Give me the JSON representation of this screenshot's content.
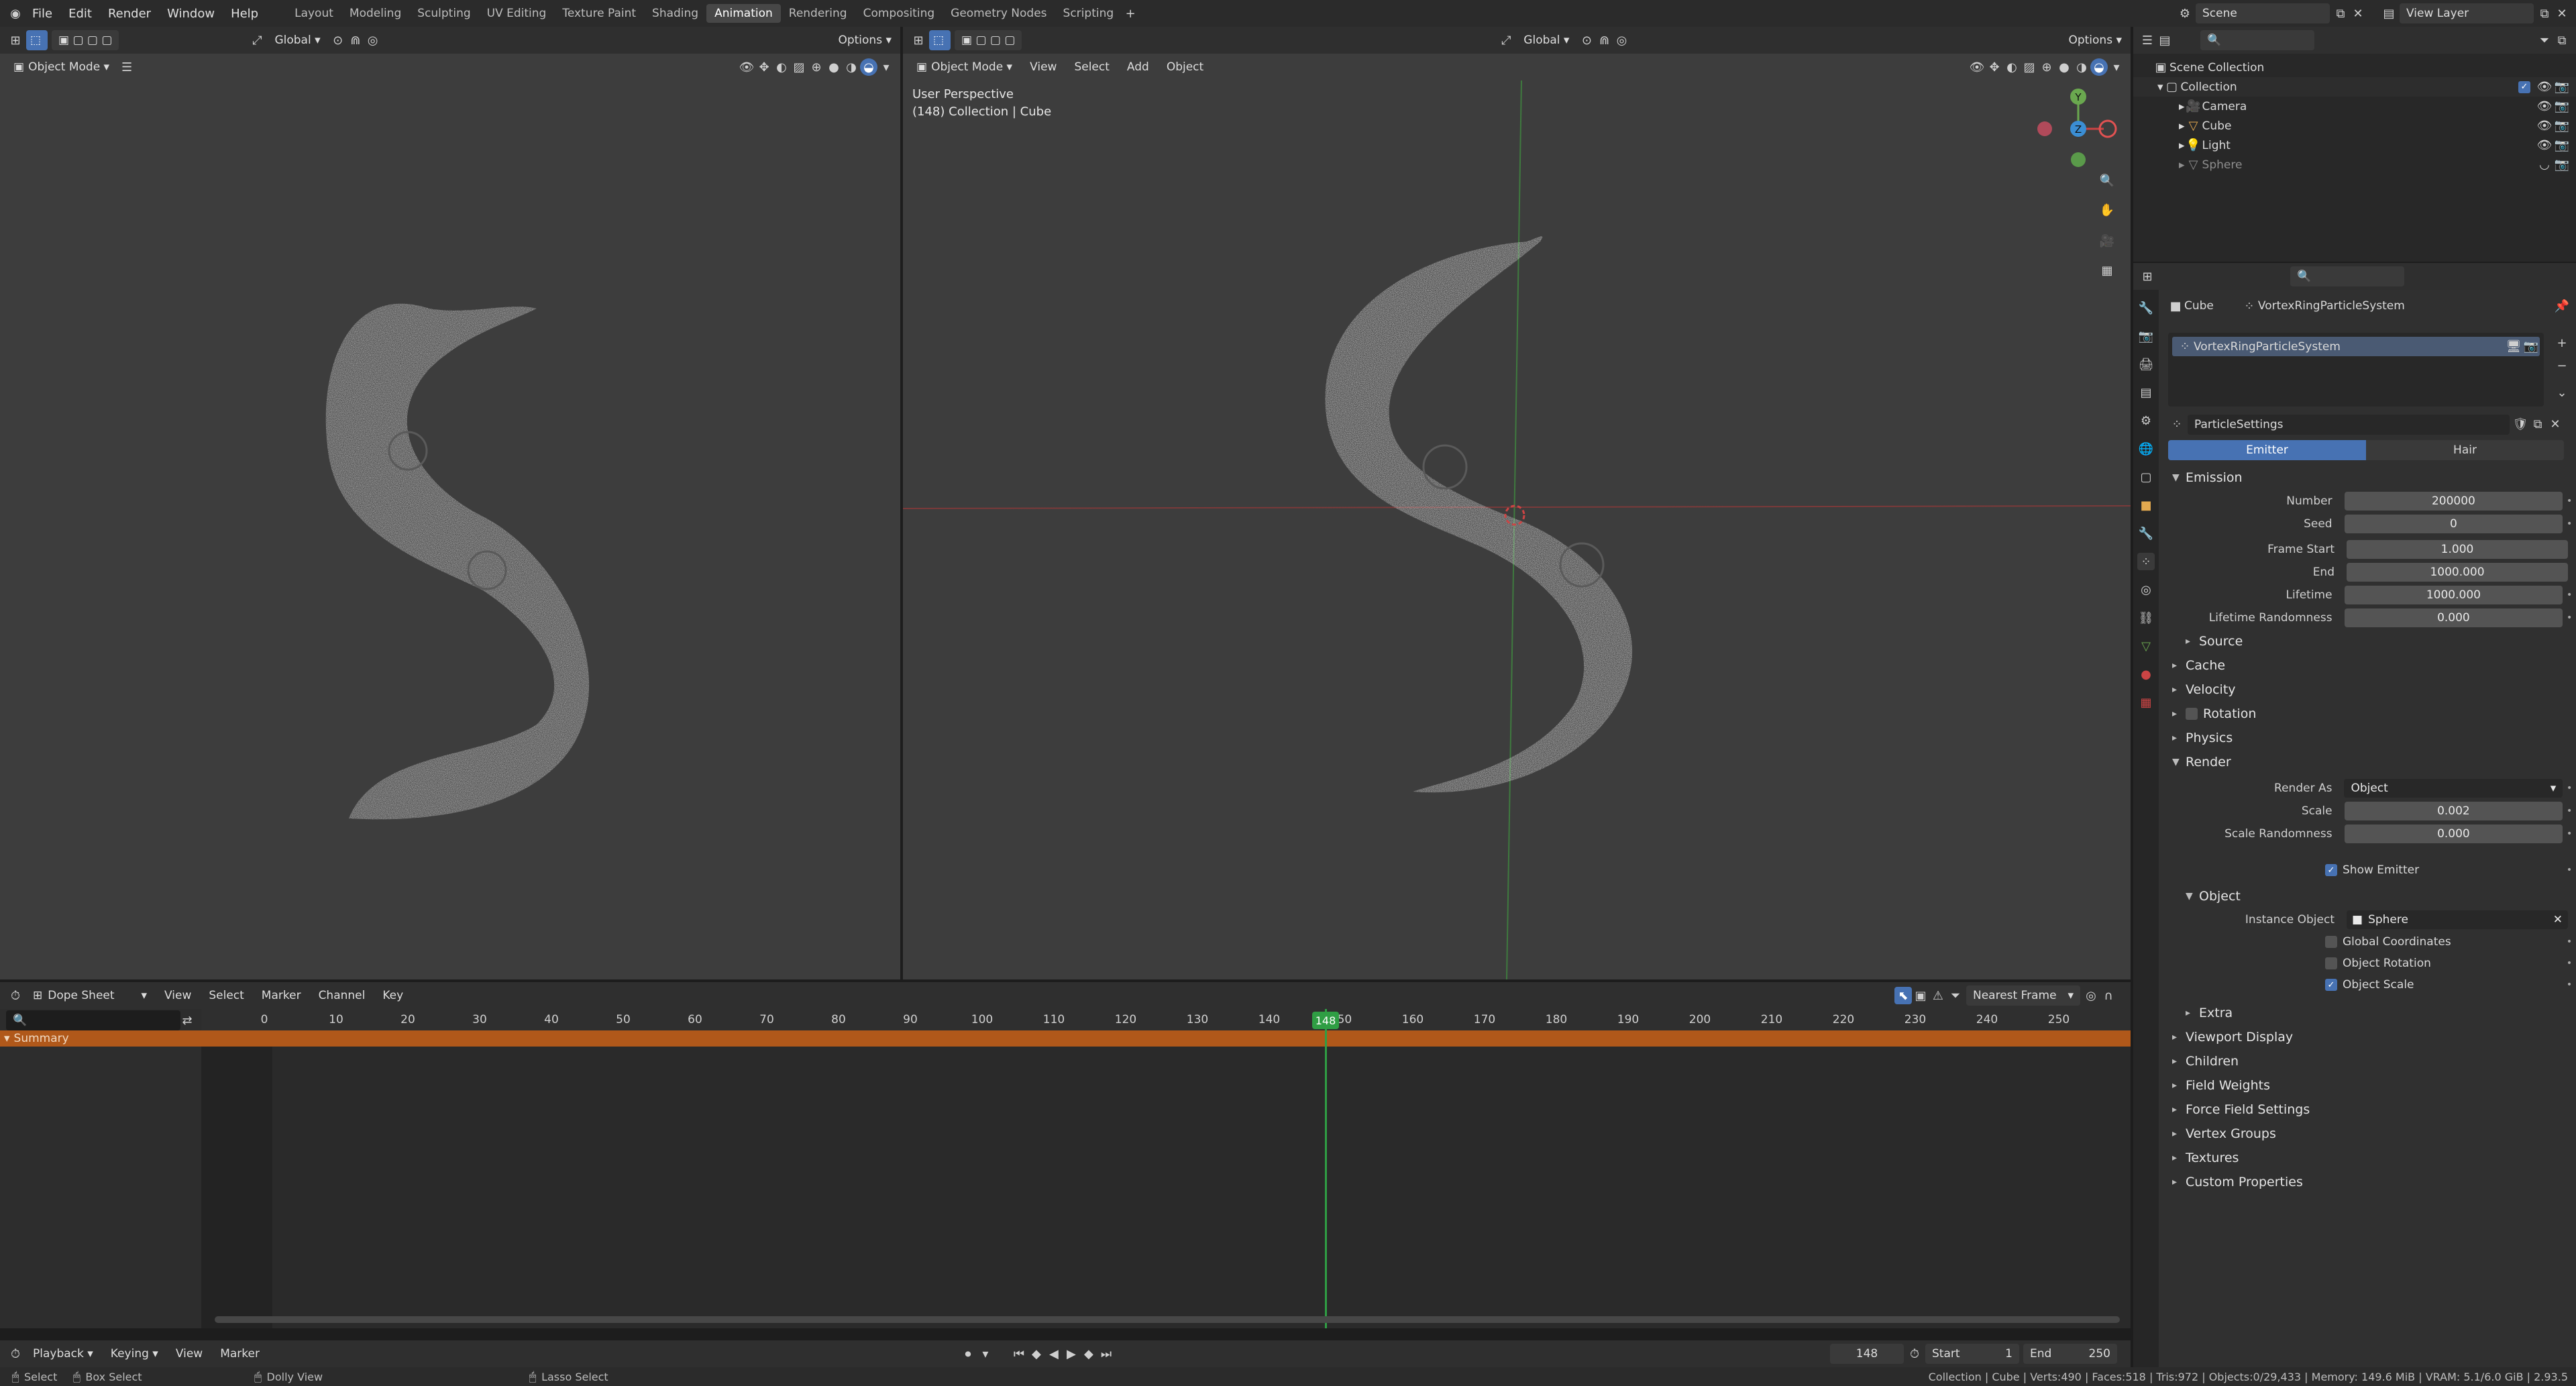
{
  "topbar": {
    "menus": [
      "File",
      "Edit",
      "Render",
      "Window",
      "Help"
    ],
    "workspaces": [
      "Layout",
      "Modeling",
      "Sculpting",
      "UV Editing",
      "Texture Paint",
      "Shading",
      "Animation",
      "Rendering",
      "Compositing",
      "Geometry Nodes",
      "Scripting"
    ],
    "active_workspace": "Animation",
    "scene": "Scene",
    "view_layer": "View Layer"
  },
  "left_viewport": {
    "transform": "Global",
    "options": "Options",
    "mode": "Object Mode"
  },
  "main_viewport": {
    "transform": "Global",
    "options": "Options",
    "mode": "Object Mode",
    "menus": [
      "View",
      "Select",
      "Add",
      "Object"
    ],
    "overlay_line1": "User Perspective",
    "overlay_line2": "(148) Collection | Cube",
    "gizmo": {
      "y": "Y",
      "z": "Z"
    }
  },
  "outliner": {
    "root": "Scene Collection",
    "collection": "Collection",
    "items": [
      {
        "name": "Camera",
        "icon": "camera-icon",
        "color": "#e3a94f"
      },
      {
        "name": "Cube",
        "icon": "mesh-icon",
        "color": "#e3a94f"
      },
      {
        "name": "Light",
        "icon": "light-icon",
        "color": "#e3a94f"
      },
      {
        "name": "Sphere",
        "icon": "mesh-icon",
        "color": "#8e8e8e"
      }
    ]
  },
  "properties": {
    "breadcrumb_object": "Cube",
    "breadcrumb_system": "VortexRingParticleSystem",
    "system_list_item": "VortexRingParticleSystem",
    "settings_name": "ParticleSettings",
    "tabs": [
      "Emitter",
      "Hair"
    ],
    "active_tab": "Emitter",
    "emission": {
      "title": "Emission",
      "rows": [
        {
          "label": "Number",
          "value": "200000"
        },
        {
          "label": "Seed",
          "value": "0"
        },
        {
          "label": "Frame Start",
          "value": "1.000"
        },
        {
          "label": "End",
          "value": "1000.000"
        },
        {
          "label": "Lifetime",
          "value": "1000.000"
        },
        {
          "label": "Lifetime Randomness",
          "value": "0.000"
        }
      ],
      "source": "Source"
    },
    "collapsed_sections_1": [
      "Cache",
      "Velocity",
      "Rotation",
      "Physics"
    ],
    "render": {
      "title": "Render",
      "render_as_label": "Render As",
      "render_as": "Object",
      "scale_label": "Scale",
      "scale": "0.002",
      "scale_rand_label": "Scale Randomness",
      "scale_rand": "0.000",
      "show_emitter": "Show Emitter",
      "object_sub": "Object",
      "instance_label": "Instance Object",
      "instance": "Sphere",
      "checks": [
        {
          "label": "Global Coordinates",
          "checked": false
        },
        {
          "label": "Object Rotation",
          "checked": false
        },
        {
          "label": "Object Scale",
          "checked": true
        }
      ],
      "extra": "Extra"
    },
    "collapsed_sections_2": [
      "Viewport Display",
      "Children",
      "Field Weights",
      "Force Field Settings",
      "Vertex Groups",
      "Textures",
      "Custom Properties"
    ]
  },
  "dopesheet": {
    "editor": "Dope Sheet",
    "menus": [
      "View",
      "Select",
      "Marker",
      "Channel",
      "Key"
    ],
    "snap": "Nearest Frame",
    "summary": "Summary",
    "ticks": [
      "0",
      "10",
      "20",
      "30",
      "40",
      "50",
      "60",
      "70",
      "80",
      "90",
      "100",
      "110",
      "120",
      "130",
      "140",
      "150",
      "160",
      "170",
      "180",
      "190",
      "200",
      "210",
      "220",
      "230",
      "240",
      "250"
    ],
    "current_frame": "148"
  },
  "timeline": {
    "menus": [
      "Playback",
      "Keying",
      "View",
      "Marker"
    ],
    "frame": "148",
    "start_label": "Start",
    "start": "1",
    "end_label": "End",
    "end": "250"
  },
  "statusbar": {
    "select": "Select",
    "box_select": "Box Select",
    "dolly": "Dolly View",
    "lasso": "Lasso Select",
    "stats": "Collection | Cube | Verts:490 | Faces:518 | Tris:972 | Objects:0/29,433 | Memory: 149.6 MiB | VRAM: 5.1/6.0 GiB | 2.93.5"
  },
  "colors": {
    "accent": "#4772b3",
    "summary": "#b0581a",
    "playhead": "#2f9e44",
    "axis_red": "#9e3434",
    "axis_green": "#3f8f3f"
  }
}
